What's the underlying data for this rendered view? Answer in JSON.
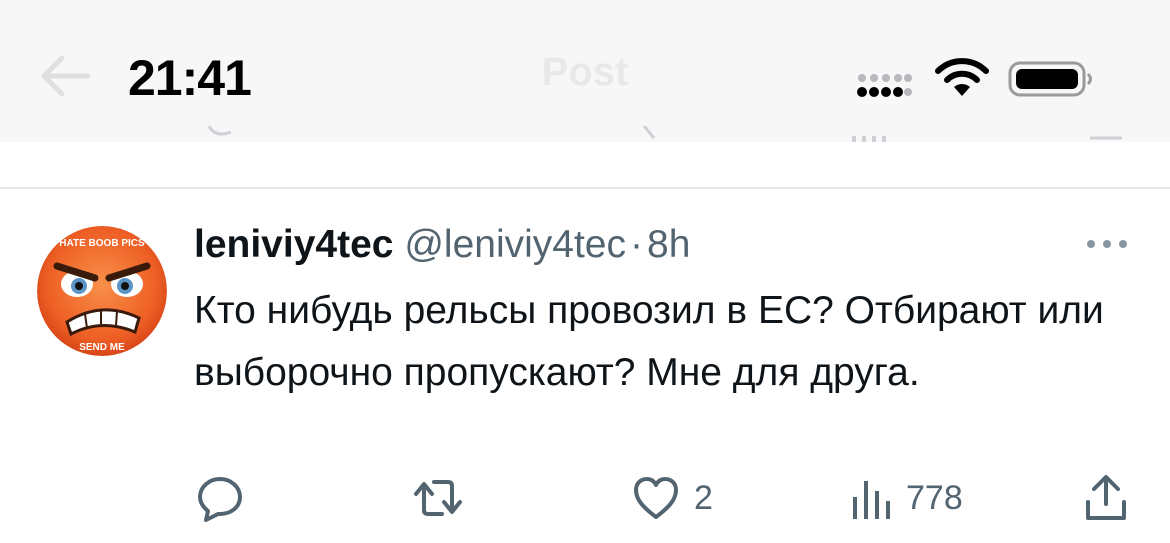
{
  "status_bar": {
    "time": "21:41",
    "signal_icon": "cellular-signal-icon",
    "wifi_icon": "wifi-icon",
    "battery_icon": "battery-icon"
  },
  "nav": {
    "title": "Post",
    "back_icon": "back-arrow-icon"
  },
  "tweet": {
    "display_name": "leniviy4tec",
    "handle": "@leniviy4tec",
    "separator": "·",
    "time": "8h",
    "text": "Кто нибудь рельсы провозил в ЕС? Отбирают или выборочно пропускают? Мне для друга.",
    "avatar_text_top": "HATE BOOB PICS",
    "avatar_text_bottom": "SEND ME",
    "more_icon": "more-dots-icon"
  },
  "actions": {
    "reply_icon": "reply-icon",
    "retweet_icon": "retweet-icon",
    "like_icon": "heart-icon",
    "like_count": "2",
    "views_icon": "views-chart-icon",
    "views_count": "778",
    "share_icon": "share-icon"
  },
  "colors": {
    "text": "#0f1419",
    "secondary": "#536471",
    "status_bg": "#f7f7f8",
    "divider": "#e6e8ea"
  }
}
